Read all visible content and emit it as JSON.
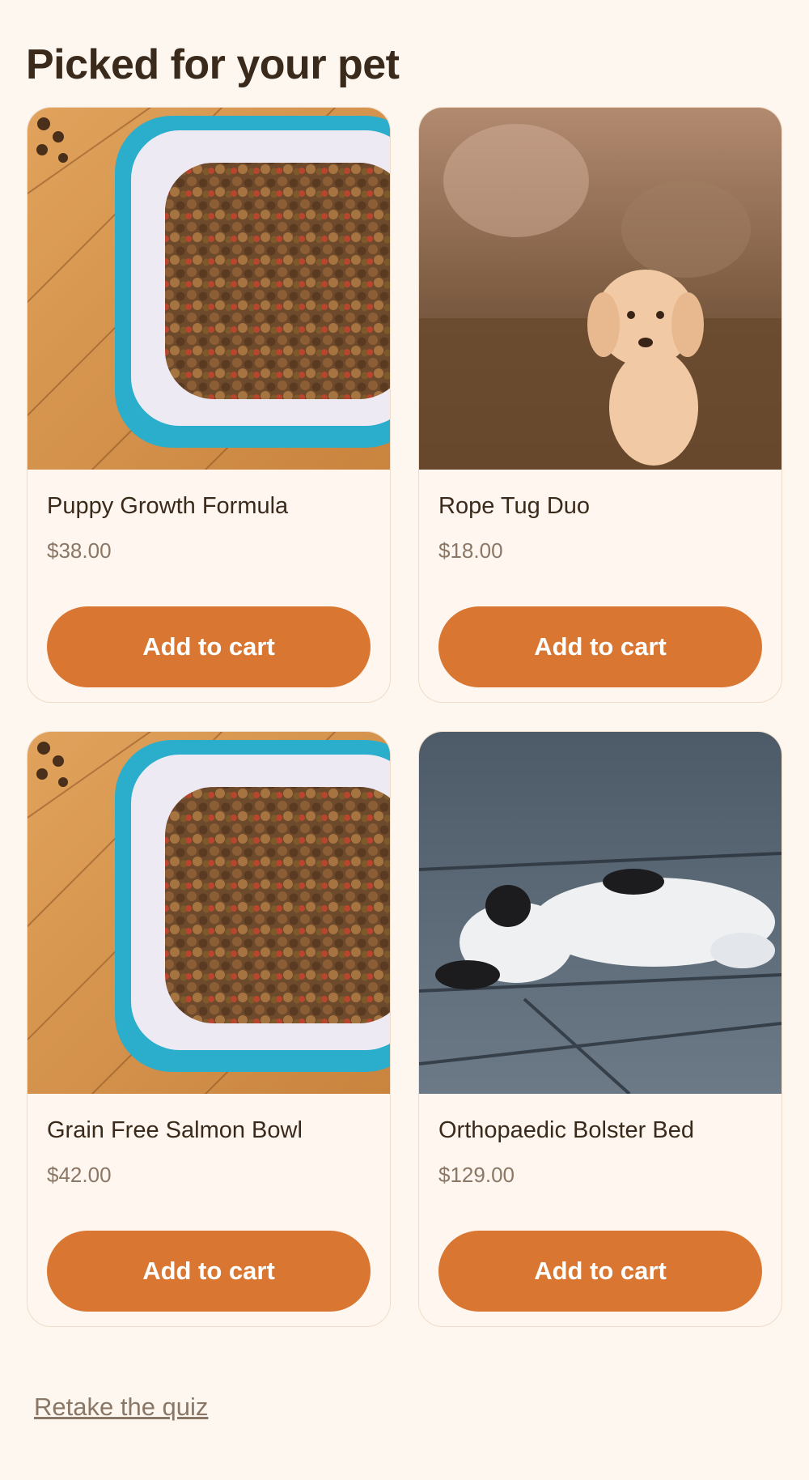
{
  "page": {
    "title": "Picked for your pet"
  },
  "products": [
    {
      "name": "Puppy Growth Formula",
      "price": "$38.00",
      "button_label": "Add to cart",
      "image": "dog-food-bowl-photo"
    },
    {
      "name": "Rope Tug Duo",
      "price": "$18.00",
      "button_label": "Add to cart",
      "image": "golden-puppy-running-photo"
    },
    {
      "name": "Grain Free Salmon Bowl",
      "price": "$42.00",
      "button_label": "Add to cart",
      "image": "dog-food-bowl-photo"
    },
    {
      "name": "Orthopaedic Bolster Bed",
      "price": "$129.00",
      "button_label": "Add to cart",
      "image": "sleeping-puppy-photo"
    }
  ],
  "footer": {
    "retake_label": "Retake the quiz"
  },
  "colors": {
    "background": "#fdf7f0",
    "accent": "#d97732",
    "text": "#3a2a1c",
    "muted": "#8a7766"
  }
}
